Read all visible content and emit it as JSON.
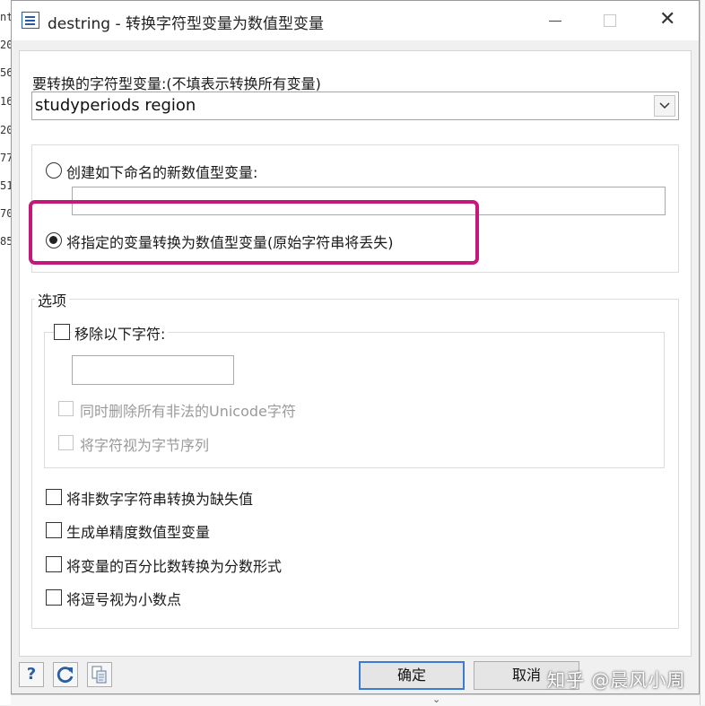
{
  "window": {
    "title": "destring - 转换字符型变量为数值型变量"
  },
  "background": {
    "row_fragments": [
      "nt",
      "20",
      "56",
      "16",
      "20",
      "77",
      "51",
      "70",
      "85"
    ]
  },
  "variables": {
    "label": "要转换的字符型变量:(不填表示转换所有变量)",
    "value": "studyperiods region"
  },
  "mode": {
    "generate_label": "创建如下命名的新数值型变量:",
    "generate_selected": false,
    "generate_name": "",
    "replace_label": "将指定的变量转换为数值型变量(原始字符串将丢失)",
    "replace_selected": true
  },
  "options": {
    "legend": "选项",
    "ignore_label": "移除以下字符:",
    "ignore_checked": false,
    "ignore_chars": "",
    "illegal_label": "同时删除所有非法的Unicode字符",
    "bytes_label": "将字符视为字节序列",
    "force_label": "将非数字字符串转换为缺失值",
    "float_label": "生成单精度数值型变量",
    "percent_label": "将变量的百分比数转换为分数形式",
    "dpcomma_label": "将逗号视为小数点"
  },
  "buttons": {
    "help": "?",
    "ok": "确定",
    "cancel": "取消"
  },
  "watermark": "知乎 @晨风小周",
  "colors": {
    "highlight": "#c4187a",
    "accent": "#2c5da0",
    "default_button_border": "#3a7bd5"
  }
}
